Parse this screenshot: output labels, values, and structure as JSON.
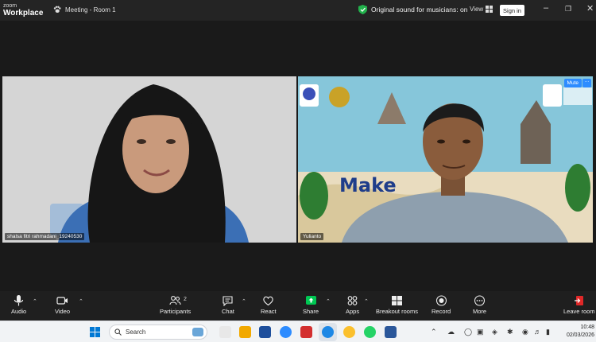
{
  "titlebar": {
    "brand_line1": "zoom",
    "brand_line2": "Workplace",
    "meeting_label": "Meeting - Room 1",
    "sound_label": "Original sound for musicians: on",
    "view_label": "View",
    "signin_label": "Sign in"
  },
  "participants": {
    "left_name": "shalsa fitri rahmadani_19240530",
    "right_name": "Yulianto",
    "mute_label": "Mute",
    "more_label": "···",
    "banner_text": "Make"
  },
  "toolbar": {
    "audio": "Audio",
    "video": "Video",
    "participants": "Participants",
    "participants_count": "2",
    "chat": "Chat",
    "react": "React",
    "share": "Share",
    "apps": "Apps",
    "breakout": "Breakout rooms",
    "record": "Record",
    "more": "More",
    "leave": "Leave room"
  },
  "taskbar": {
    "search_placeholder": "Search",
    "time": "10:48",
    "date": "02/03/2026"
  },
  "colors": {
    "zoom_blue": "#2d8cff",
    "share_green": "#00c853",
    "leave_red": "#e02828"
  }
}
